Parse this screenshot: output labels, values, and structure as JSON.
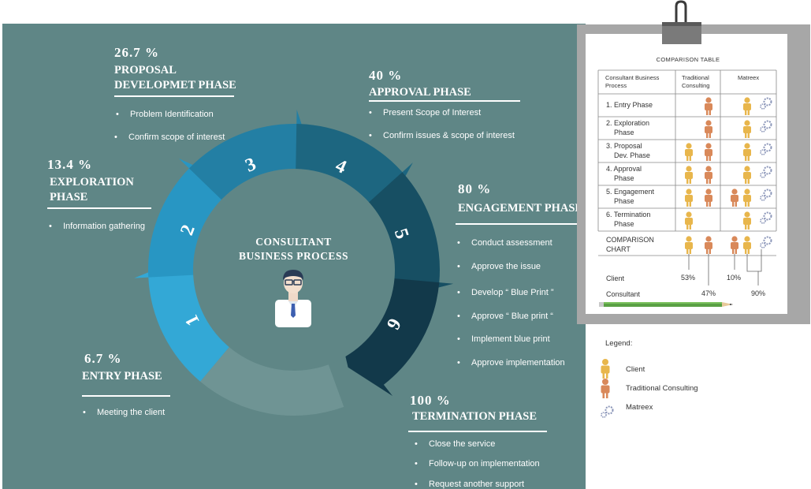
{
  "colors": {
    "panel": "#5f8686",
    "seg1": "#33a8d6",
    "seg2": "#2896c3",
    "seg3": "#237fa4",
    "seg4": "#1d6680",
    "seg5": "#174f63",
    "seg6": "#12394a",
    "person_client": "#e8b64c",
    "person_traditional": "#d9895a",
    "gear": "#8a95b8",
    "pencil": "#5aa044"
  },
  "center": {
    "title_line1": "CONSULTANT",
    "title_line2": "BUSINESS PROCESS",
    "icon": "consultant-person-icon"
  },
  "segments": [
    {
      "number": "1"
    },
    {
      "number": "2"
    },
    {
      "number": "3"
    },
    {
      "number": "4"
    },
    {
      "number": "5"
    },
    {
      "number": "6"
    }
  ],
  "phases": {
    "entry": {
      "percent": "6.7 %",
      "title": "ENTRY PHASE",
      "items": [
        "Meeting the client"
      ]
    },
    "exploration": {
      "percent": "13.4 %",
      "title_line1": "EXPLORATION",
      "title_line2": "PHASE",
      "items": [
        "Information gathering"
      ]
    },
    "proposal": {
      "percent": "26.7 %",
      "title_line1": "PROPOSAL",
      "title_line2": "DEVELOPMET PHASE",
      "items": [
        "Problem Identification",
        "Confirm scope of interest"
      ]
    },
    "approval": {
      "percent": "40 %",
      "title": "APPROVAL PHASE",
      "items": [
        "Present Scope of Interest",
        "Confirm issues & scope of interest"
      ]
    },
    "engagement": {
      "percent": "80 %",
      "title": "ENGAGEMENT PHASE",
      "items": [
        "Conduct assessment",
        "Approve the issue",
        "Develop “ Blue Print ”",
        "Approve “ Blue print “",
        "Implement blue print",
        "Approve implementation"
      ]
    },
    "termination": {
      "percent": "100 %",
      "title": "TERMINATION PHASE",
      "items": [
        "Close the service",
        "Follow-up on implementation",
        "Request another support"
      ]
    }
  },
  "comparison": {
    "title": "COMPARISON  TABLE",
    "headers": [
      "Consultant Business Process",
      "Traditional Consulting",
      "Matreex"
    ],
    "header_lines": [
      [
        "Consultant Business",
        "Process"
      ],
      [
        "Traditional",
        "Consulting"
      ],
      [
        "Matreex"
      ]
    ],
    "rows": [
      {
        "line1": "1. Entry Phase",
        "line2": "",
        "traditional": {
          "client": false,
          "traditional": true
        },
        "matreex": {
          "client": true,
          "traditional": false
        }
      },
      {
        "line1": "2. Exploration",
        "line2": "Phase",
        "traditional": {
          "client": false,
          "traditional": true
        },
        "matreex": {
          "client": true,
          "traditional": false
        }
      },
      {
        "line1": "3. Proposal",
        "line2": "Dev. Phase",
        "traditional": {
          "client": true,
          "traditional": true
        },
        "matreex": {
          "client": true,
          "traditional": false
        }
      },
      {
        "line1": "4. Approval",
        "line2": "Phase",
        "traditional": {
          "client": true,
          "traditional": true
        },
        "matreex": {
          "client": true,
          "traditional": false
        }
      },
      {
        "line1": "5. Engagement",
        "line2": "Phase",
        "traditional": {
          "client": true,
          "traditional": true
        },
        "matreex": {
          "client": true,
          "traditional": true
        }
      },
      {
        "line1": "6. Termination",
        "line2": "Phase",
        "traditional": {
          "client": true,
          "traditional": false
        },
        "matreex": {
          "client": true,
          "traditional": false
        }
      }
    ],
    "chart_label_line1": "COMPARISON",
    "chart_label_line2": "CHART",
    "client_label": "Client",
    "consultant_label": "Consultant",
    "traditional_client_pct": "53%",
    "traditional_consultant_pct": "47%",
    "matreex_consultant_pct": "10%",
    "matreex_client_pct": "90%"
  },
  "legend": {
    "title": "Legend:",
    "items": [
      {
        "label": "Client",
        "icon": "client-person-icon"
      },
      {
        "label": "Traditional Consulting",
        "icon": "traditional-person-icon"
      },
      {
        "label": "Matreex",
        "icon": "gears-icon"
      }
    ]
  }
}
